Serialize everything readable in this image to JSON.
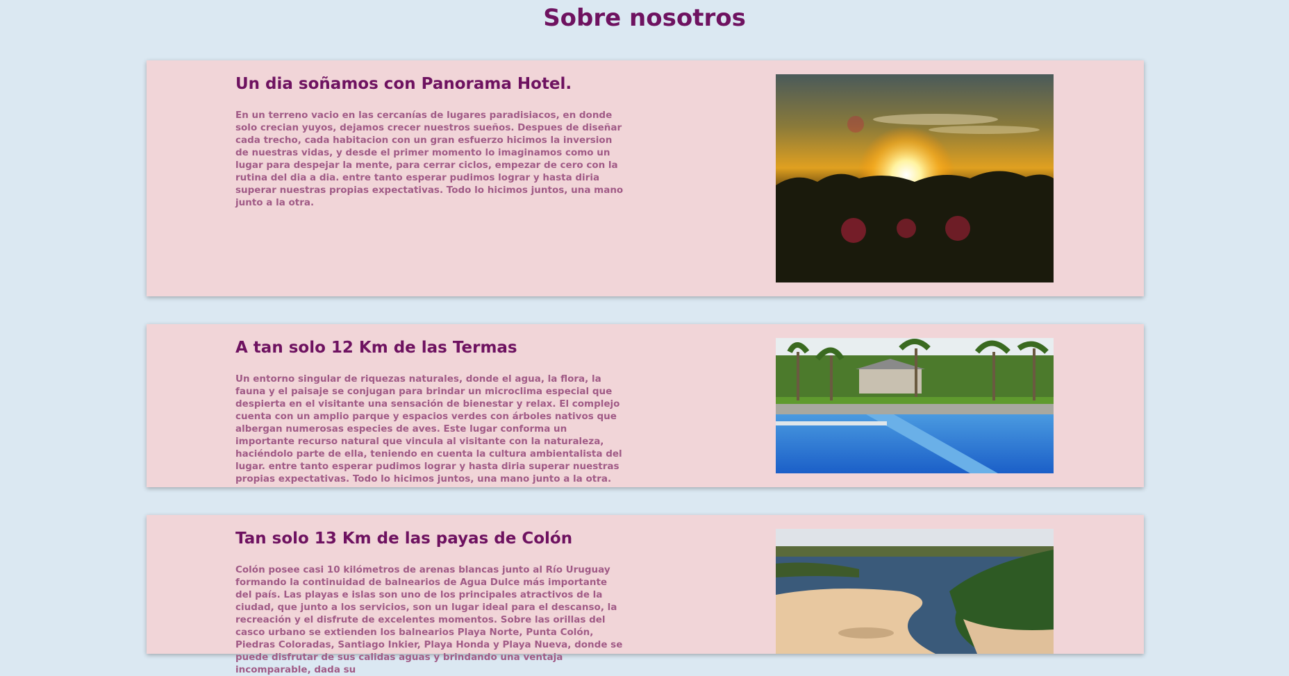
{
  "page": {
    "title": "Sobre nosotros"
  },
  "sections": [
    {
      "title": "Un dia soñamos con Panorama Hotel.",
      "text": "En un terreno vacio en las cercanías de lugares paradisiacos, en donde solo crecian yuyos, dejamos crecer nuestros sueños. Despues de diseñar cada trecho, cada habitacion con un gran esfuerzo hicimos la inversion de nuestras vidas, y desde el primer momento lo imaginamos como un lugar para despejar la mente, para cerrar ciclos, empezar de cero con la rutina del dia a dia. entre tanto esperar pudimos lograr y hasta diria superar nuestras propias expectativas. Todo lo hicimos juntos, una mano junto a la otra.",
      "image": "sunset-photo"
    },
    {
      "title": "A tan solo 12 Km de las Termas",
      "text": "Un entorno singular de riquezas naturales, donde el agua, la flora, la fauna y el paisaje se conjugan para brindar un microclima especial que despierta en el visitante una sensación de bienestar y relax. El complejo cuenta con un amplio parque y espacios verdes con árboles nativos que albergan numerosas especies de aves. Este lugar conforma un importante recurso natural que vincula al visitante con la naturaleza, haciéndolo parte de ella, teniendo en cuenta la cultura ambientalista del lugar. entre tanto esperar pudimos lograr y hasta diria superar nuestras propias expectativas. Todo lo hicimos juntos, una mano junto a la otra.",
      "image": "pool-photo"
    },
    {
      "title": "Tan solo 13 Km de las payas de Colón",
      "text": "Colón posee casi 10 kilómetros de arenas blancas junto al Río Uruguay formando la continuidad de balnearios de Agua Dulce más importante del país. Las playas e islas son uno de los principales atractivos de la ciudad, que junto a los servicios, son un lugar ideal para el descanso, la recreación y el disfrute de excelentes momentos. Sobre las orillas del casco urbano se extienden los balnearios Playa Norte, Punta Colón, Piedras Coloradas, Santiago Inkier, Playa Honda y Playa Nueva, donde se puede disfrutar de sus calidas aguas y brindando una ventaja incomparable, dada su",
      "image": "beach-river-photo"
    }
  ],
  "colors": {
    "background": "#dbe8f2",
    "card": "#f1d5d8",
    "heading": "#6e1260",
    "body_text": "#a05a86"
  }
}
